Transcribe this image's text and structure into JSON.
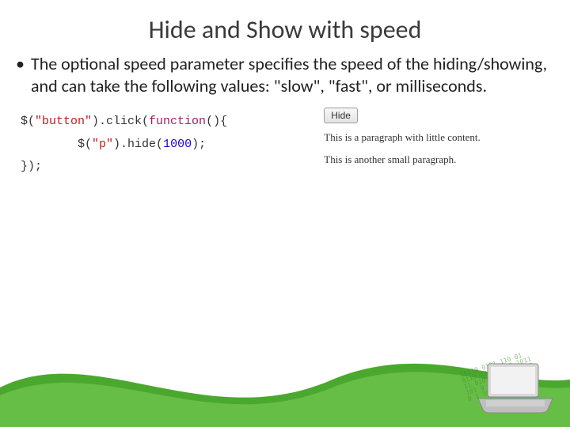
{
  "title": "Hide and Show with speed",
  "bullet": "The optional speed parameter specifies the speed of the hiding/showing, and can take the following values: \"slow\", \"fast\", or milliseconds.",
  "code": {
    "dollar1": "$(",
    "sel_button": "\"button\"",
    "paren_dot_click": ").click(",
    "fn_kw": "function",
    "fn_rest": "(){",
    "indent": "        ",
    "dollar2": "$(",
    "sel_p": "\"p\"",
    "paren_dot_hide": ").hide(",
    "num": "1000",
    "close_hide": ");",
    "close_fn": "});"
  },
  "example": {
    "button": "Hide",
    "p1": "This is a paragraph with little content.",
    "p2": "This is another small paragraph."
  }
}
